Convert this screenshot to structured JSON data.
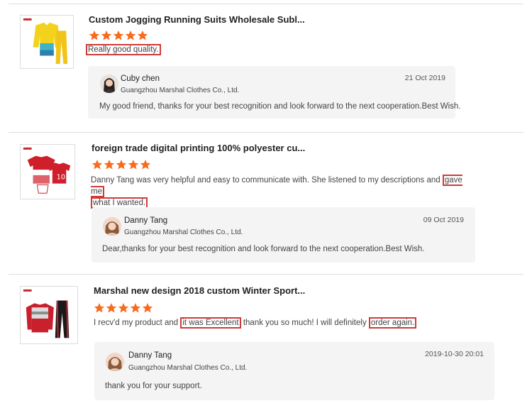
{
  "star_color": "#f76b1c",
  "highlight_color": "#d03a3a",
  "reviews": [
    {
      "product_title": "Custom Jogging Running Suits Wholesale Subl...",
      "rating": 5,
      "text_segments": [
        {
          "text": "Really good quality.",
          "highlight": true
        }
      ],
      "reply": {
        "name": "Cuby chen",
        "company": "Guangzhou Marshal Clothes Co., Ltd.",
        "date": "21 Oct 2019",
        "message": "My good friend, thanks for your best recognition and look forward to the next cooperation.Best Wish."
      }
    },
    {
      "product_title": "foreign trade digital printing 100% polyester cu...",
      "rating": 5,
      "text_segments": [
        {
          "text": "Danny Tang was very helpful and easy to communicate with. She listened to my descriptions and ",
          "highlight": false
        },
        {
          "text": "gave me",
          "highlight": true
        },
        {
          "text": "what I wanted.",
          "highlight": true,
          "newline": true
        }
      ],
      "reply": {
        "name": "Danny Tang",
        "company": "Guangzhou Marshal Clothes Co., Ltd.",
        "date": "09 Oct 2019",
        "message": "Dear,thanks for your best recognition and look forward to the next cooperation.Best Wish."
      }
    },
    {
      "product_title": "Marshal new design 2018 custom Winter Sport...",
      "rating": 5,
      "text_segments": [
        {
          "text": "I recv'd my product and ",
          "highlight": false
        },
        {
          "text": "it was Excellent",
          "highlight": true
        },
        {
          "text": " thank you so much! I will definitely ",
          "highlight": false
        },
        {
          "text": "order again.",
          "highlight": true
        }
      ],
      "reply": {
        "name": "Danny Tang",
        "company": "Guangzhou Marshal Clothes Co., Ltd.",
        "date": "2019-10-30 20:01",
        "message": "thank you for your support."
      }
    }
  ]
}
